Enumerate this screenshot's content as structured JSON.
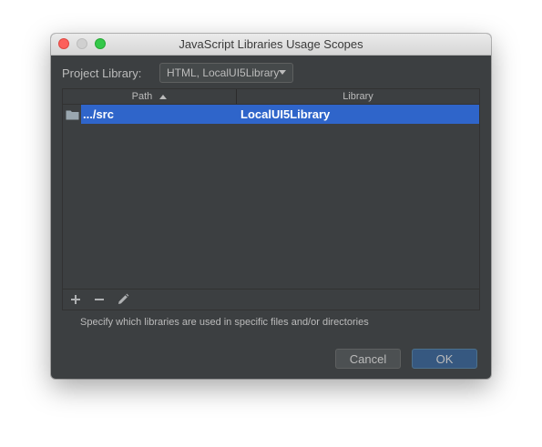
{
  "window": {
    "title": "JavaScript Libraries Usage Scopes"
  },
  "project_library": {
    "label": "Project Library:",
    "selected": "HTML, LocalUI5Library"
  },
  "table": {
    "columns": [
      "Path",
      "Library"
    ],
    "sorted_column": "Path",
    "sort_direction": "ascending",
    "rows": [
      {
        "path": ".../src",
        "library": "LocalUI5Library",
        "icon": "folder-icon",
        "selected": true
      }
    ]
  },
  "toolbar": {
    "add_icon": "plus-icon",
    "remove_icon": "minus-icon",
    "edit_icon": "pencil-icon"
  },
  "hint": "Specify which libraries are used in specific files and/or directories",
  "buttons": {
    "cancel": "Cancel",
    "ok": "OK"
  },
  "colors": {
    "background": "#3c3f41",
    "selection": "#2f65ca",
    "default_button": "#365880"
  }
}
